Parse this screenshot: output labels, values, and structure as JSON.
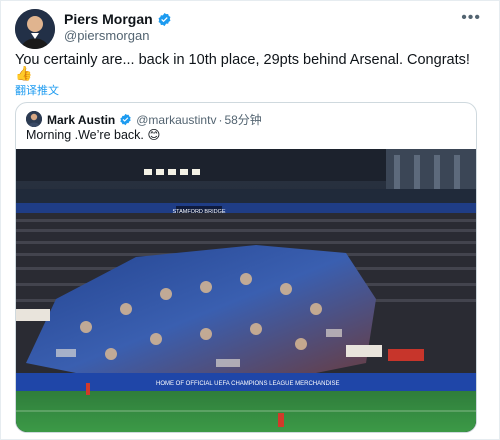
{
  "author": {
    "name": "Piers Morgan",
    "handle": "@piersmorgan"
  },
  "more_label": "•••",
  "tweet": {
    "text": "You certainly are... back in 10th place, 29pts behind Arsenal. Congrats!",
    "emoji": "👍",
    "translate_label": "翻译推文"
  },
  "quoted": {
    "name": "Mark Austin",
    "handle": "@markaustintv",
    "separator": "·",
    "time": "58分钟",
    "text": "Morning .We’re back. 😊",
    "media": {
      "stand_banner": "STAMFORD BRIDGE",
      "ad_board": "HOME OF OFFICIAL UEFA CHAMPIONS LEAGUE MERCHANDISE"
    }
  },
  "colors": {
    "verified": "#1d9bf0",
    "link": "#1d9bf0",
    "secondary_text": "#536471",
    "border": "#cfd9de",
    "pitch": "#2f7d3b",
    "stand_blue": "#1f3d86"
  },
  "icons": [
    "verified-badge-icon",
    "more-options-icon"
  ]
}
